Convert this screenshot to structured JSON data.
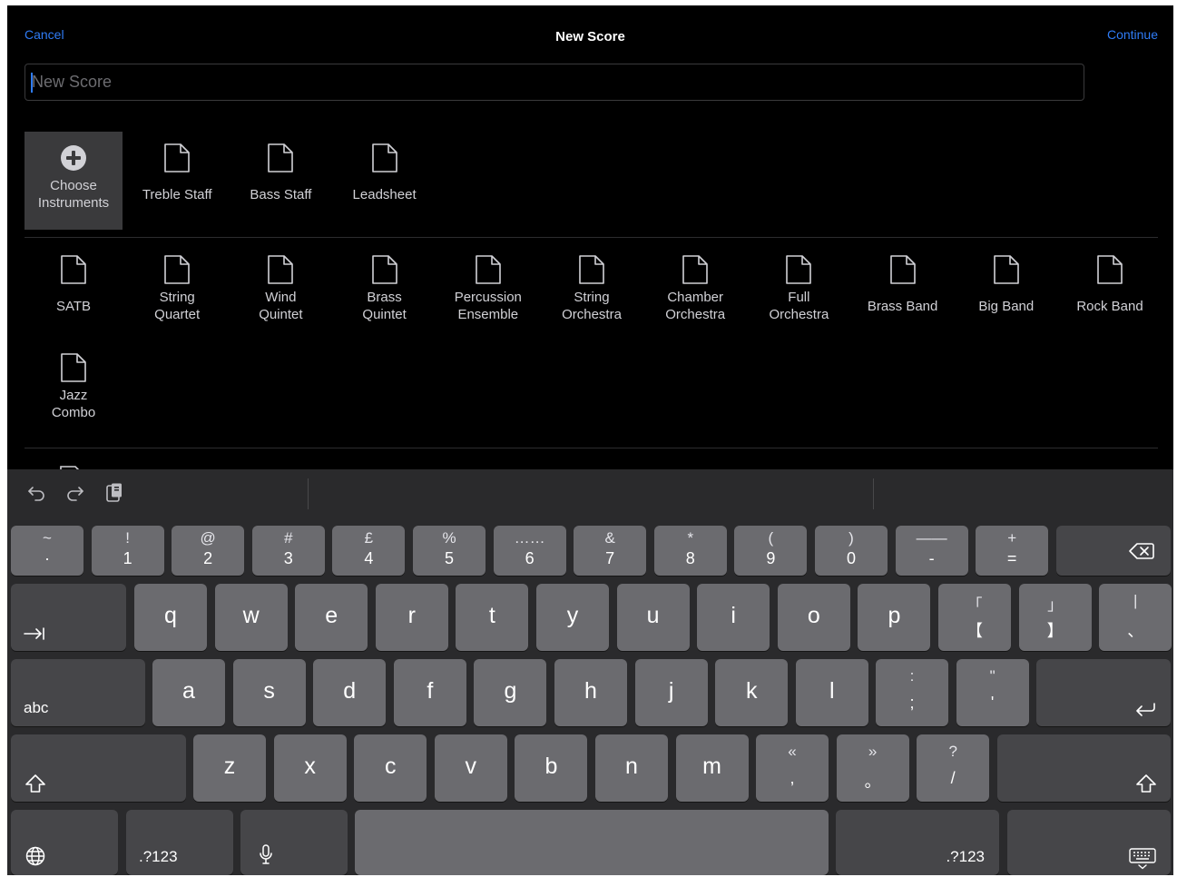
{
  "nav": {
    "cancel": "Cancel",
    "title": "New Score",
    "continue": "Continue"
  },
  "title_field": {
    "value": "",
    "placeholder": "New Score"
  },
  "quick_templates": [
    {
      "label": "Choose\nInstruments",
      "icon": "plus-circle-icon"
    },
    {
      "label": "Treble Staff",
      "icon": "document-icon"
    },
    {
      "label": "Bass Staff",
      "icon": "document-icon"
    },
    {
      "label": "Leadsheet",
      "icon": "document-icon"
    }
  ],
  "ensemble_templates": [
    {
      "label": "SATB"
    },
    {
      "label": "String\nQuartet"
    },
    {
      "label": "Wind\nQuintet"
    },
    {
      "label": "Brass\nQuintet"
    },
    {
      "label": "Percussion\nEnsemble"
    },
    {
      "label": "String\nOrchestra"
    },
    {
      "label": "Chamber\nOrchestra"
    },
    {
      "label": "Full\nOrchestra"
    },
    {
      "label": "Brass Band"
    },
    {
      "label": "Big Band"
    },
    {
      "label": "Rock Band"
    },
    {
      "label": "Jazz\nCombo"
    }
  ],
  "keyboard": {
    "shortcuts": [
      "undo-icon",
      "redo-icon",
      "paste-icon"
    ],
    "row1": [
      {
        "top": "~",
        "bottom": "·"
      },
      {
        "top": "!",
        "bottom": "1"
      },
      {
        "top": "@",
        "bottom": "2"
      },
      {
        "top": "#",
        "bottom": "3"
      },
      {
        "top": "£",
        "bottom": "4"
      },
      {
        "top": "%",
        "bottom": "5"
      },
      {
        "top": "……",
        "bottom": "6"
      },
      {
        "top": "&",
        "bottom": "7"
      },
      {
        "top": "*",
        "bottom": "8"
      },
      {
        "top": "(",
        "bottom": "9"
      },
      {
        "top": ")",
        "bottom": "0"
      },
      {
        "top": "——",
        "bottom": "-"
      },
      {
        "top": "+",
        "bottom": "="
      }
    ],
    "row2": [
      "q",
      "w",
      "e",
      "r",
      "t",
      "y",
      "u",
      "i",
      "o",
      "p"
    ],
    "row2_extra": [
      {
        "top": "「",
        "bottom": "【"
      },
      {
        "top": "」",
        "bottom": "】"
      },
      {
        "top": "|",
        "bottom": "、"
      }
    ],
    "row3": [
      "a",
      "s",
      "d",
      "f",
      "g",
      "h",
      "j",
      "k",
      "l"
    ],
    "row3_extra": [
      {
        "top": ":",
        "bottom": ";"
      },
      {
        "top": "\"",
        "bottom": "'"
      }
    ],
    "row4": [
      "z",
      "x",
      "c",
      "v",
      "b",
      "n",
      "m"
    ],
    "row4_extra": [
      {
        "top": "«",
        "bottom": ","
      },
      {
        "top": "»",
        "bottom": "。"
      },
      {
        "top": "?",
        "bottom": "/"
      }
    ],
    "abc_label": "abc",
    "numbers_label_left": ".?123",
    "numbers_label_right": ".?123"
  }
}
